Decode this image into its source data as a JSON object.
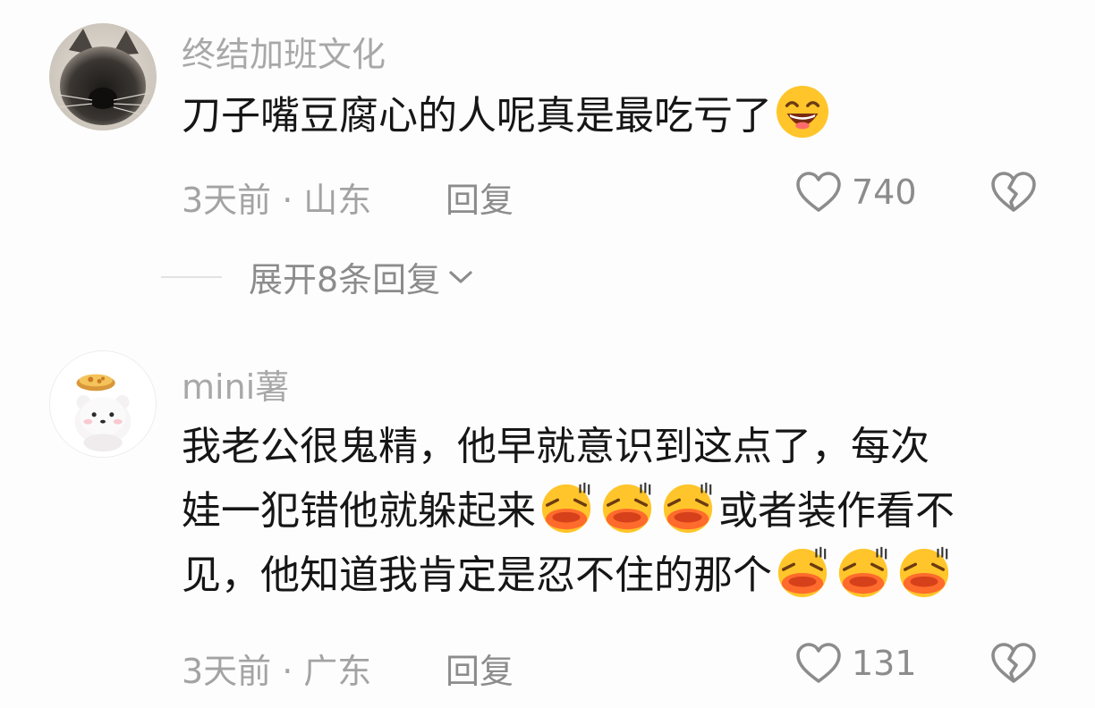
{
  "comments": [
    {
      "username": "终结加班文化",
      "avatar_icon": "cat-avatar",
      "text_before_emoji": "刀子嘴豆腐心的人呢真是最吃亏了",
      "emoji_icons": [
        "grin-emoji"
      ],
      "time": "3天前",
      "separator": "·",
      "location": "山东",
      "reply_label": "回复",
      "like_count": "740"
    },
    {
      "username": "mini薯",
      "avatar_icon": "bear-egg-tart-avatar",
      "line1": "我老公很鬼精，他早就意识到这点了，每次",
      "line2_before": "娃一犯错他就躲起来",
      "line2_after": "或者装作看不",
      "line3_before": "见，他知道我肯定是忍不住的那个",
      "emoji_icons": [
        "laugh-cry-emoji",
        "laugh-cry-emoji",
        "laugh-cry-emoji"
      ],
      "time": "3天前",
      "separator": "·",
      "location": "广东",
      "reply_label": "回复",
      "like_count": "131"
    }
  ],
  "expand_replies": {
    "label": "展开8条回复"
  },
  "colors": {
    "background": "#fdfdfd",
    "text": "#161616",
    "muted": "#a3a3a3",
    "icon": "#8c8c8c",
    "emoji_yellow": "#ffc52a",
    "emoji_orange": "#ff6b2c"
  }
}
